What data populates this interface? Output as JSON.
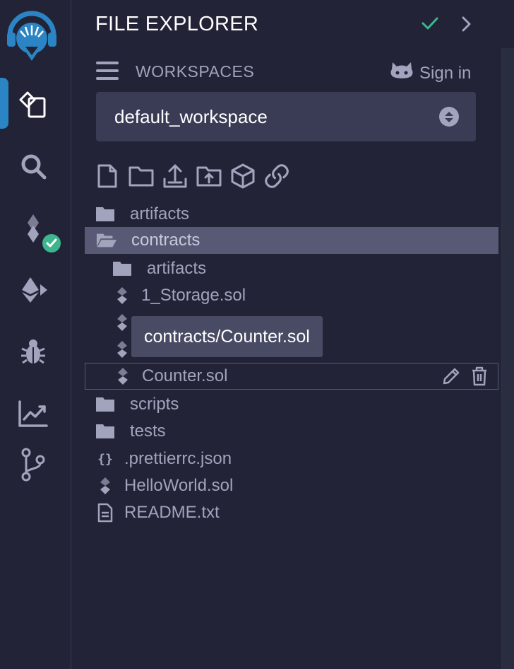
{
  "colors": {
    "background": "#222336",
    "accent": "#2b84c4",
    "success": "#3db68e",
    "text": "#a2a3bd",
    "selected_row": "#585a75",
    "tooltip_bg": "#494b64"
  },
  "icon_panel": {
    "items": [
      {
        "icon": "remix-logo-icon"
      },
      {
        "icon": "file-explorer-icon",
        "active": true
      },
      {
        "icon": "search-icon"
      },
      {
        "icon": "solidity-compiler-icon",
        "badge": "check-icon"
      },
      {
        "icon": "ethereum-deploy-icon"
      },
      {
        "icon": "debugger-bug-icon"
      },
      {
        "icon": "analytics-chart-icon"
      },
      {
        "icon": "git-branch-icon"
      }
    ]
  },
  "header": {
    "title": "FILE EXPLORER",
    "status_icon": "check-icon",
    "collapse_icon": "chevron-right-icon"
  },
  "workspaces": {
    "label": "WORKSPACES",
    "menu_icon": "hamburger-icon",
    "signin_label": "Sign in",
    "signin_icon": "github-icon",
    "selected": "default_workspace"
  },
  "toolbar": {
    "icons": [
      "new-file-icon",
      "new-folder-icon",
      "upload-file-icon",
      "upload-folder-icon",
      "publish-gist-icon",
      "link-icon"
    ]
  },
  "tree": {
    "items": [
      {
        "label": "artifacts",
        "icon": "folder-icon"
      },
      {
        "label": "contracts",
        "icon": "folder-open-icon",
        "selected": true
      },
      {
        "label": "artifacts",
        "icon": "folder-icon"
      },
      {
        "label": "1_Storage.sol",
        "icon": "solidity-file-icon"
      },
      {
        "label": "",
        "icon": "solidity-file-icon"
      },
      {
        "label": "",
        "icon": "solidity-file-icon"
      },
      {
        "label": "Counter.sol",
        "icon": "solidity-file-icon",
        "hover": true
      },
      {
        "label": "scripts",
        "icon": "folder-icon"
      },
      {
        "label": "tests",
        "icon": "folder-icon"
      },
      {
        "label": ".prettierrc.json",
        "icon": "json-braces-icon"
      },
      {
        "label": "HelloWorld.sol",
        "icon": "solidity-file-icon"
      },
      {
        "label": "README.txt",
        "icon": "text-file-icon"
      }
    ],
    "tooltip": "contracts/Counter.sol",
    "row_actions": [
      "edit-pencil-icon",
      "delete-trash-icon"
    ]
  }
}
